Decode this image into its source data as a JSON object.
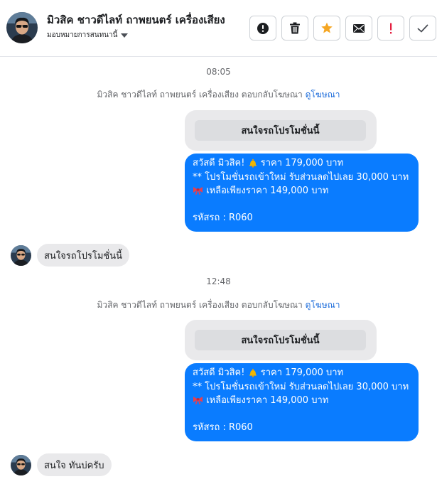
{
  "header": {
    "contact_name": "มิวสิค ชาวดีไลท์ ถาพยนตร์ เครื่องเสียง",
    "assign_label": "มอบหมายการสนทนานี้",
    "actions": [
      {
        "icon": "info-circle-icon"
      },
      {
        "icon": "trash-icon"
      },
      {
        "icon": "star-icon"
      },
      {
        "icon": "envelope-icon"
      },
      {
        "icon": "exclamation-icon"
      },
      {
        "icon": "check-icon"
      }
    ]
  },
  "colors": {
    "accent": "#0a7cff",
    "link": "#216fdb",
    "star": "#f5a623",
    "alert": "#e41e3f"
  },
  "thread": {
    "groups": [
      {
        "time": "08:05",
        "system_text": "มิวสิค ชาวดีไลท์ ถาพยนตร์ เครื่องเสียง ตอบกลับโฆษณา ",
        "system_link": "ดูโฆษณา",
        "quick_reply": "สนใจรถโปรโมชั่นนี้",
        "out_lines": [
          "สวัสดี มิวสิค! ",
          "ราคา 179,000 บาท",
          "** โปรโมชั่นรถเข้าใหม่ รับส่วนลดไปเลย 30,000 บาท",
          " เหลือเพียงราคา 149,000 บาท",
          "รหัสรถ : R060"
        ],
        "in_message": "สนใจรถโปรโมชั่นนี้"
      },
      {
        "time": "12:48",
        "system_text": "มิวสิค ชาวดีไลท์ ถาพยนตร์ เครื่องเสียง ตอบกลับโฆษณา ",
        "system_link": "ดูโฆษณา",
        "quick_reply": "สนใจรถโปรโมชั่นนี้",
        "out_lines": [
          "สวัสดี มิวสิค! ",
          "ราคา 179,000 บาท",
          "** โปรโมชั่นรถเข้าใหม่ รับส่วนลดไปเลย 30,000 บาท",
          " เหลือเพียงราคา 149,000 บาท",
          "รหัสรถ : R060"
        ],
        "in_message": "สนใจ ทันบ่ครับ"
      }
    ]
  }
}
